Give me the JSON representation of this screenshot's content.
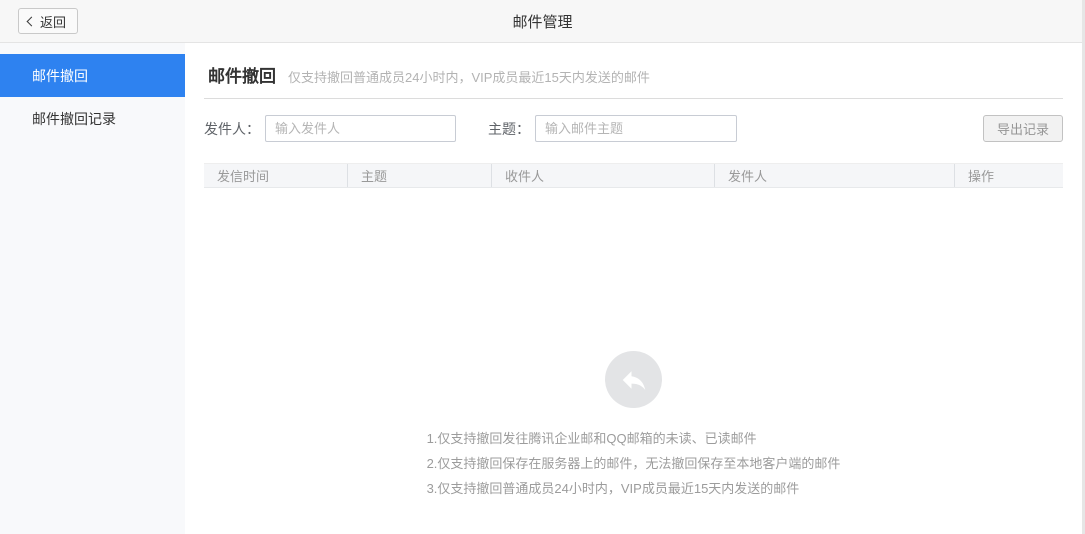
{
  "header": {
    "back_label": "返回",
    "title": "邮件管理"
  },
  "sidebar": {
    "items": [
      {
        "label": "邮件撤回",
        "active": true
      },
      {
        "label": "邮件撤回记录",
        "active": false
      }
    ]
  },
  "main": {
    "title": "邮件撤回",
    "subtitle": "仅支持撤回普通成员24小时内，VIP成员最近15天内发送的邮件",
    "filters": {
      "sender_label": "发件人：",
      "sender_placeholder": "输入发件人",
      "sender_value": "",
      "subject_label": "主题：",
      "subject_placeholder": "输入邮件主题",
      "subject_value": "",
      "export_button_label": "导出记录"
    },
    "table": {
      "columns": [
        "发信时间",
        "主题",
        "收件人",
        "发件人",
        "操作"
      ],
      "rows": []
    },
    "empty_state": {
      "icon": "recall-undo-arrow-icon",
      "notes": [
        "1.仅支持撤回发往腾讯企业邮和QQ邮箱的未读、已读邮件",
        "2.仅支持撤回保存在服务器上的邮件，无法撤回保存至本地客户端的邮件",
        "3.仅支持撤回普通成员24小时内，VIP成员最近15天内发送的邮件"
      ]
    }
  },
  "icons": {
    "back": "chevron-left-icon",
    "empty": "recall-undo-arrow-icon"
  },
  "colors": {
    "accent": "#2e82f0",
    "header_bg": "#f7f7f7",
    "sidebar_bg": "#f8f9fb",
    "table_head_bg": "#f5f6f8",
    "empty_icon_bg": "#e3e4e6"
  }
}
